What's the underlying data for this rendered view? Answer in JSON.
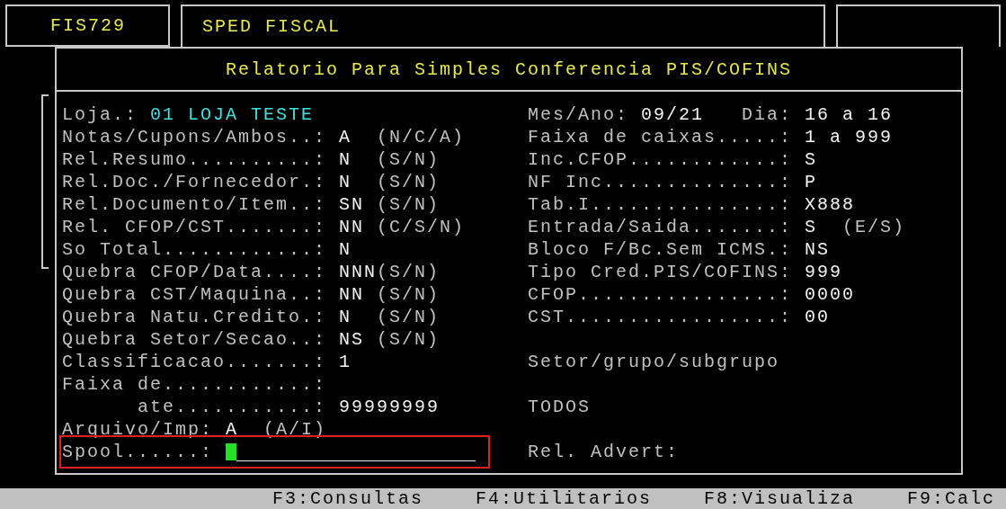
{
  "header": {
    "program_code": "FIS729",
    "module": "SPED FISCAL"
  },
  "panel": {
    "title": "Relatorio Para Simples Conferencia PIS/COFINS",
    "lines": [
      {
        "left": [
          {
            "kind": "info",
            "label": "Loja.:",
            "value": "01 LOJA TESTE"
          }
        ],
        "right": [
          {
            "kind": "field",
            "label": "Mes/Ano:",
            "value": "09/21"
          },
          {
            "kind": "field",
            "label": "Dia:",
            "value": "16 a 16"
          }
        ]
      },
      {
        "left": [
          {
            "kind": "field",
            "label": "Notas/Cupons/Ambos..:",
            "value": "A",
            "hint": "(N/C/A)"
          }
        ],
        "right": [
          {
            "kind": "field",
            "label": "Faixa de caixas.....:",
            "value": "1 a 999"
          }
        ]
      },
      {
        "left": [
          {
            "kind": "field",
            "label": "Rel.Resumo..........:",
            "value": "N",
            "hint": "(S/N)"
          }
        ],
        "right": [
          {
            "kind": "field",
            "label": "Inc.CFOP............:",
            "value": "S"
          }
        ]
      },
      {
        "left": [
          {
            "kind": "field",
            "label": "Rel.Doc./Fornecedor.:",
            "value": "N",
            "hint": "(S/N)"
          }
        ],
        "right": [
          {
            "kind": "field",
            "label": "NF Inc..............:",
            "value": "P"
          }
        ]
      },
      {
        "left": [
          {
            "kind": "field",
            "label": "Rel.Documento/Item..:",
            "value": "SN",
            "hint": "(S/N)"
          }
        ],
        "right": [
          {
            "kind": "field",
            "label": "Tab.I...............:",
            "value": "X888"
          }
        ]
      },
      {
        "left": [
          {
            "kind": "field",
            "label": "Rel. CFOP/CST.......:",
            "value": "NN",
            "hint": "(C/S/N)"
          }
        ],
        "right": [
          {
            "kind": "field",
            "label": "Entrada/Saida.......:",
            "value": "S",
            "hint": "(E/S)"
          }
        ]
      },
      {
        "left": [
          {
            "kind": "field",
            "label": "So Total............:",
            "value": "N"
          }
        ],
        "right": [
          {
            "kind": "field",
            "label": "Bloco F/Bc.Sem ICMS.:",
            "value": "NS"
          }
        ]
      },
      {
        "left": [
          {
            "kind": "field",
            "label": "Quebra CFOP/Data....:",
            "value": "NNN",
            "hint": "(S/N)"
          }
        ],
        "right": [
          {
            "kind": "field",
            "label": "Tipo Cred.PIS/COFINS:",
            "value": "999"
          }
        ]
      },
      {
        "left": [
          {
            "kind": "field",
            "label": "Quebra CST/Maquina..:",
            "value": "NN",
            "hint": "(S/N)"
          }
        ],
        "right": [
          {
            "kind": "field",
            "label": "CFOP................:",
            "value": "0000"
          }
        ]
      },
      {
        "left": [
          {
            "kind": "field",
            "label": "Quebra Natu.Credito.:",
            "value": "N",
            "hint": "(S/N)"
          }
        ],
        "right": [
          {
            "kind": "field",
            "label": "CST.................:",
            "value": "00"
          }
        ]
      },
      {
        "left": [
          {
            "kind": "field",
            "label": "Quebra Setor/Secao..:",
            "value": "NS",
            "hint": "(S/N)"
          }
        ]
      },
      {
        "left": [
          {
            "kind": "field",
            "label": "Classificacao.......:",
            "value": "1"
          }
        ],
        "right": [
          {
            "kind": "text",
            "label": "Setor/grupo/subgrupo"
          }
        ]
      },
      {
        "left": [
          {
            "kind": "field",
            "label": "Faixa de............:"
          }
        ]
      },
      {
        "left": [
          {
            "kind": "field",
            "label": "ate...........:",
            "value": "99999999",
            "indent": true
          }
        ],
        "right": [
          {
            "kind": "text",
            "label": "TODOS"
          }
        ]
      },
      {
        "left": [
          {
            "kind": "field",
            "label": "Arquivo/Imp:",
            "value": "A",
            "hint": "(A/I)"
          }
        ]
      },
      {
        "left": [
          {
            "kind": "input",
            "label": "Spool......:",
            "focused": true
          }
        ],
        "right": [
          {
            "kind": "text",
            "label": "Rel. Advert:"
          }
        ]
      }
    ]
  },
  "function_keys": [
    "F3:Consultas",
    "F4:Utilitarios",
    "F8:Visualiza",
    "F9:Calc"
  ]
}
